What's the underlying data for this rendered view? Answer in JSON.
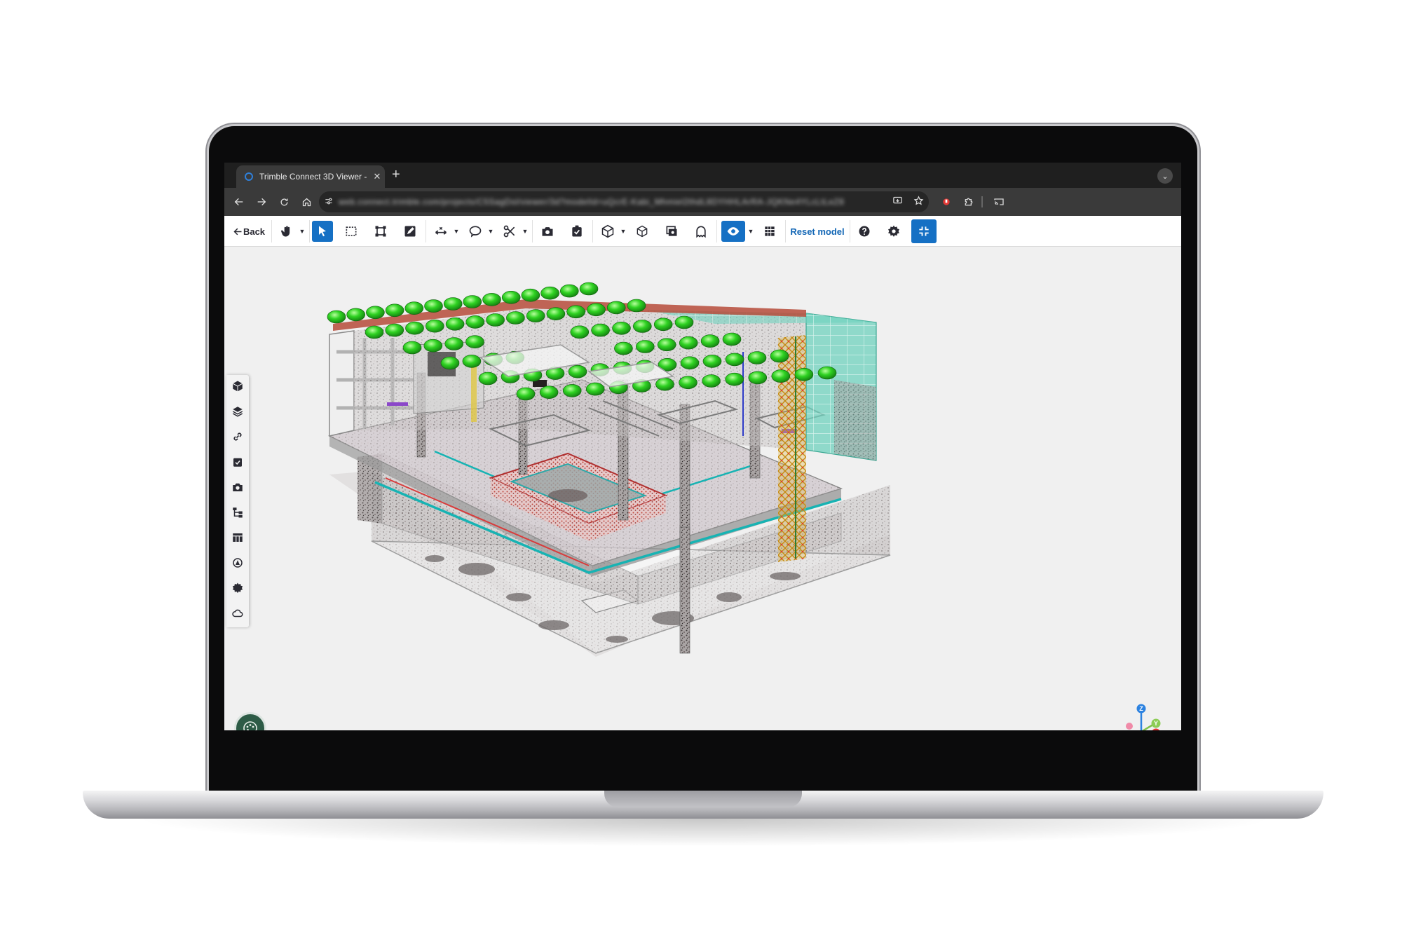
{
  "browser": {
    "tab_title": "Trimble Connect 3D Viewer -",
    "tab_close": "✕",
    "new_tab": "+",
    "tab_menu": "⌄",
    "url": "web.connect.trimble.com/projects/C5SagDsl/viewer/3d?modelId=uQcrE-Kabi_Mhmiel2thdL8DYHHLArRA-JQKNe4YLcLtLeZ8"
  },
  "toolbar": {
    "back_label": "Back",
    "reset_label": "Reset model"
  },
  "sidebar": {
    "items": [
      "models",
      "layers",
      "links",
      "todos",
      "views",
      "organizer",
      "properties",
      "clash",
      "settings",
      "cloud"
    ]
  },
  "gizmo": {
    "z_label": "Z",
    "y_label": "Y",
    "x_label": "X"
  },
  "colors": {
    "accent": "#1570c4",
    "palette_button": "#2d5b46",
    "dome_green": "#22c51e",
    "duct_teal": "#17b3b3",
    "glass_teal": "#5ec9b5"
  }
}
